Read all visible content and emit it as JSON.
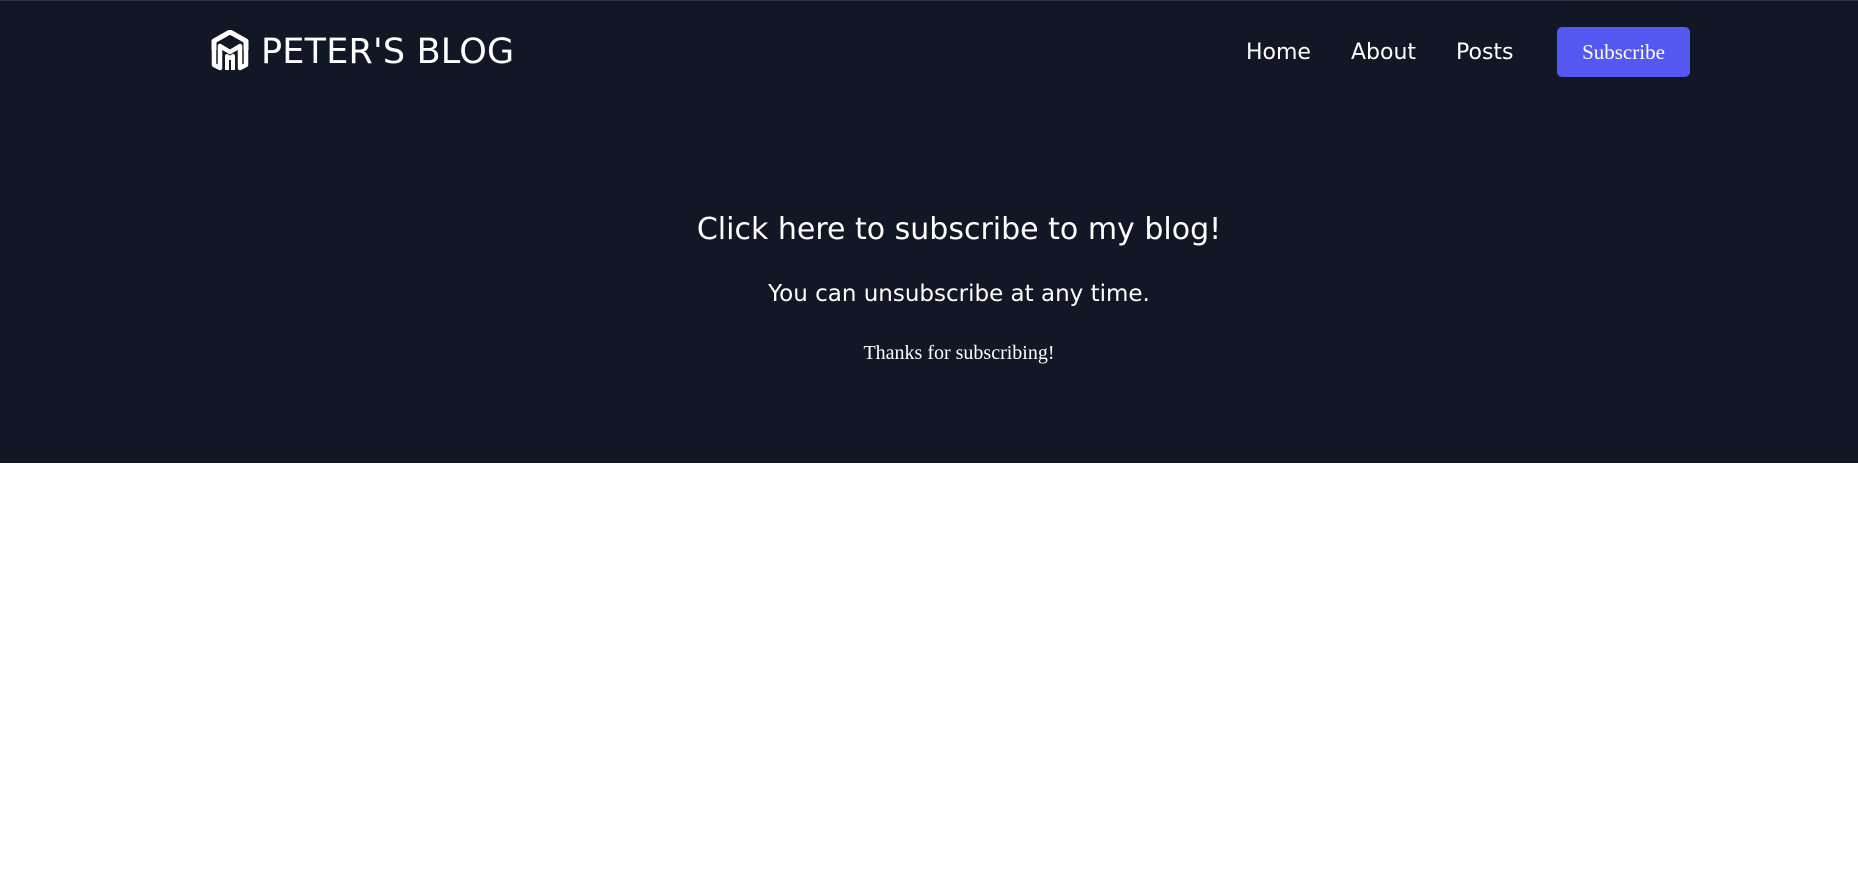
{
  "brand": {
    "title": "PETER'S BLOG",
    "icon": "hexagon-m-logo-icon"
  },
  "nav": {
    "items": [
      {
        "label": "Home"
      },
      {
        "label": "About"
      },
      {
        "label": "Posts"
      }
    ],
    "subscribe_label": "Subscribe"
  },
  "hero": {
    "heading": "Click here to subscribe to my blog!",
    "subheading": "You can unsubscribe at any time.",
    "thanks": "Thanks for subscribing!"
  },
  "colors": {
    "hero_background": "#111725",
    "accent": "#5458f0",
    "page_background": "#ffffff",
    "text": "#ffffff"
  }
}
